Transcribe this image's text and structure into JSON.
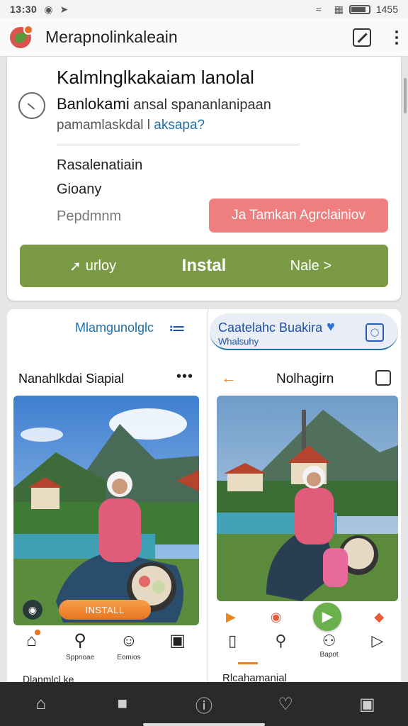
{
  "status_bar": {
    "time": "13:30",
    "battery": "1455"
  },
  "app_bar": {
    "title": "Merapnolinkaleain"
  },
  "install_card": {
    "heading": "Kalmlnglkakaiam lanolal",
    "desc_lead": "Banlokami",
    "desc_rest": "ansal spananlanipaan",
    "desc2_text": "pamamlaskdal l",
    "desc2_link": "aksapa?",
    "meta": [
      "Rasalenatiain",
      "Gioany",
      "Pepdmnm"
    ],
    "pink_button": "Ja Tamkan Agrclainiov",
    "install_bar": {
      "left": "urloy",
      "center": "Instal",
      "right": "Nale >"
    }
  },
  "left_panel": {
    "caption": "Mlamgunolglc",
    "title": "Nanahlkdai Siapial",
    "install_button": "INSTALL",
    "nav": [
      {
        "icon": "home-icon",
        "label": ""
      },
      {
        "icon": "search-icon",
        "label": "Sppnoae"
      },
      {
        "icon": "emoji-icon",
        "label": "Eomios"
      },
      {
        "icon": "square-icon",
        "label": ""
      }
    ],
    "peek_text": "Dlanmlcl ke"
  },
  "right_panel": {
    "banner_title": "Caatelahc Buakira",
    "banner_sub": "Whalsuhy",
    "title": "Nolhagirn",
    "nav": [
      {
        "icon": "bookmark-icon",
        "label": ""
      },
      {
        "icon": "search-icon",
        "label": ""
      },
      {
        "icon": "people-icon",
        "label": "Bapot"
      },
      {
        "icon": "tag-icon",
        "label": ""
      }
    ],
    "peek_text": "Rlcahamanial"
  },
  "colors": {
    "install_green": "#7a9a45",
    "pink": "#ef7f7f",
    "orange": "#e8751f",
    "link_blue": "#1e6fa8"
  }
}
